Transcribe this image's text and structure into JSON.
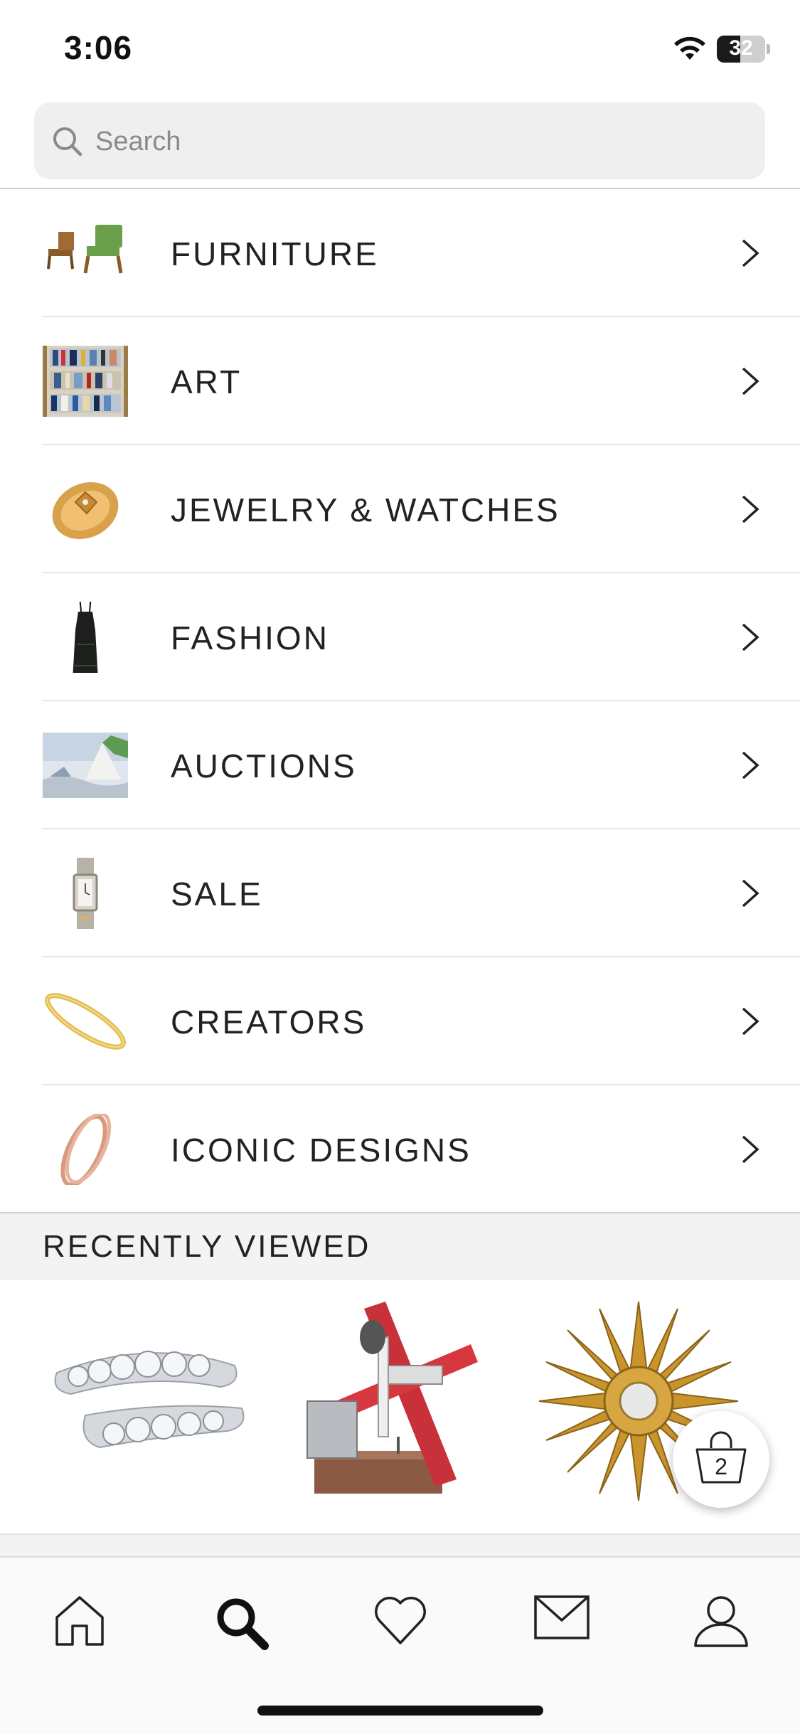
{
  "status_bar": {
    "time": "3:06",
    "battery_level": "32"
  },
  "search": {
    "placeholder": "Search",
    "value": ""
  },
  "categories": [
    {
      "label": "FURNITURE",
      "icon": "furniture-thumb"
    },
    {
      "label": "ART",
      "icon": "art-thumb"
    },
    {
      "label": "JEWELRY & WATCHES",
      "icon": "ring-thumb"
    },
    {
      "label": "FASHION",
      "icon": "dress-thumb"
    },
    {
      "label": "AUCTIONS",
      "icon": "painting-thumb"
    },
    {
      "label": "SALE",
      "icon": "watch-thumb"
    },
    {
      "label": "CREATORS",
      "icon": "bracelet-thumb"
    },
    {
      "label": "ICONIC DESIGNS",
      "icon": "rose-bracelet-thumb"
    }
  ],
  "recently_viewed": {
    "title": "RECENTLY VIEWED",
    "items": [
      {
        "icon": "diamond-ring-thumb"
      },
      {
        "icon": "sculpture-thumb"
      },
      {
        "icon": "sunburst-mirror-thumb"
      }
    ]
  },
  "bag": {
    "count": "2"
  },
  "tab_bar": {
    "tabs": [
      {
        "name": "home",
        "active": false
      },
      {
        "name": "search",
        "active": true
      },
      {
        "name": "favorites",
        "active": false
      },
      {
        "name": "messages",
        "active": false
      },
      {
        "name": "account",
        "active": false
      }
    ]
  },
  "colors": {
    "text": "#222222",
    "search_bg": "#efefef",
    "section_bg": "#f3f3f3",
    "divider": "#e4e4e4"
  }
}
